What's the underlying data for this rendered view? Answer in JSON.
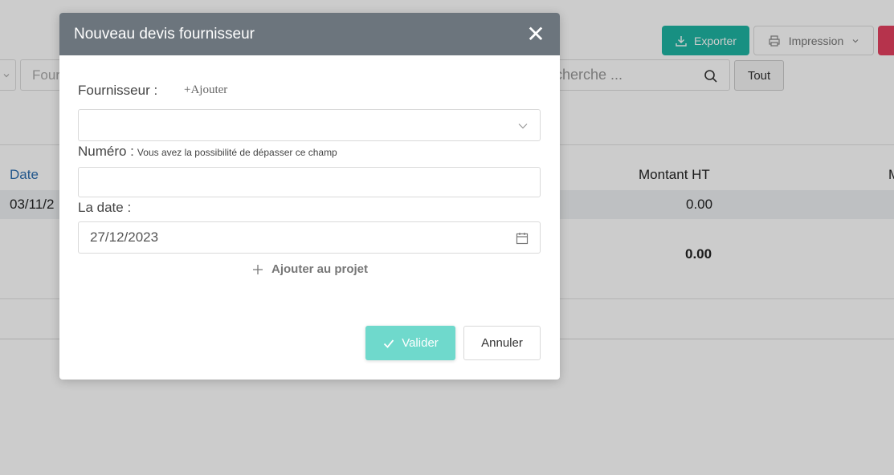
{
  "toolbar": {
    "export_label": "Exporter",
    "print_label": "Impression",
    "filter_placeholder": "Four",
    "search_placeholder": "cherche ...",
    "all_label": "Tout"
  },
  "table": {
    "headers": {
      "date": "Date",
      "amount_ht": "Montant HT",
      "next": "M"
    },
    "rows": [
      {
        "date": "03/11/2",
        "amount": "0.00"
      }
    ],
    "total": "0.00"
  },
  "modal": {
    "title": "Nouveau devis fournisseur",
    "close_glyph": "✕",
    "supplier_label": "Fournisseur :",
    "add_link": "+Ajouter",
    "supplier_value": "",
    "number_label": "Numéro :",
    "number_hint": "Vous avez la possibilité de dépasser ce champ",
    "number_value": "",
    "date_label": "La date :",
    "date_value": "27/12/2023",
    "add_project": "Ajouter au projet",
    "validate_label": "Valider",
    "cancel_label": "Annuler"
  },
  "colors": {
    "accent_teal": "#1fb5a3",
    "validate_teal": "#6fd9cc",
    "header_gray": "#6c757d",
    "danger": "#e4405f",
    "link_blue": "#2e6fb0"
  }
}
